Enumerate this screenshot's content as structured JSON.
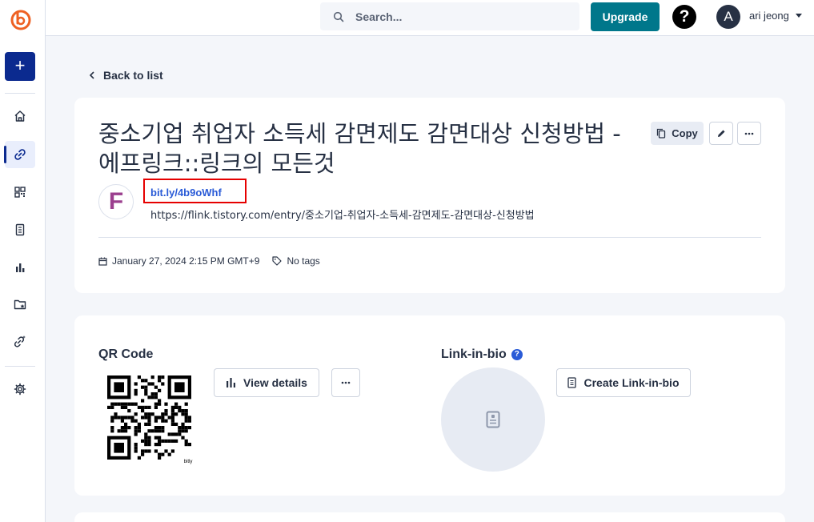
{
  "header": {
    "search_placeholder": "Search...",
    "upgrade_label": "Upgrade",
    "help_label": "?",
    "avatar_initial": "A",
    "username": "ari jeong"
  },
  "sidebar": {
    "create_label": "+",
    "items": [
      {
        "name": "home",
        "icon": "home-icon",
        "active": false
      },
      {
        "name": "links",
        "icon": "link-icon",
        "active": true
      },
      {
        "name": "qr-codes",
        "icon": "qr-icon",
        "active": false
      },
      {
        "name": "pages",
        "icon": "page-icon",
        "active": false
      },
      {
        "name": "analytics",
        "icon": "bar-chart-icon",
        "active": false
      },
      {
        "name": "campaigns",
        "icon": "folder-star-icon",
        "active": false
      },
      {
        "name": "custom-links",
        "icon": "link-sparkle-icon",
        "active": false
      },
      {
        "name": "settings",
        "icon": "gear-icon",
        "active": false
      }
    ]
  },
  "main": {
    "back_label": "Back to list",
    "link": {
      "title": "중소기업 취업자 소득세 감면제도 감면대상 신청방법 - 에프링크::링크의 모든것",
      "copy_label": "Copy",
      "favicon_letter": "F",
      "short_url": "bit.ly/4b9oWhf",
      "long_url": "https://flink.tistory.com/entry/중소기업-취업자-소득세-감면제도-감면대상-신청방법",
      "date": "January 27, 2024 2:15 PM GMT+9",
      "tags": "No tags"
    },
    "qr": {
      "title": "QR Code",
      "view_details_label": "View details",
      "brand_mark": "bitly"
    },
    "link_in_bio": {
      "title": "Link-in-bio",
      "help_label": "?",
      "create_label": "Create Link-in-bio"
    }
  },
  "colors": {
    "accent": "#0b2a8f",
    "upgrade": "#00778b",
    "link": "#2a5bd7",
    "highlight": "#e60000"
  }
}
